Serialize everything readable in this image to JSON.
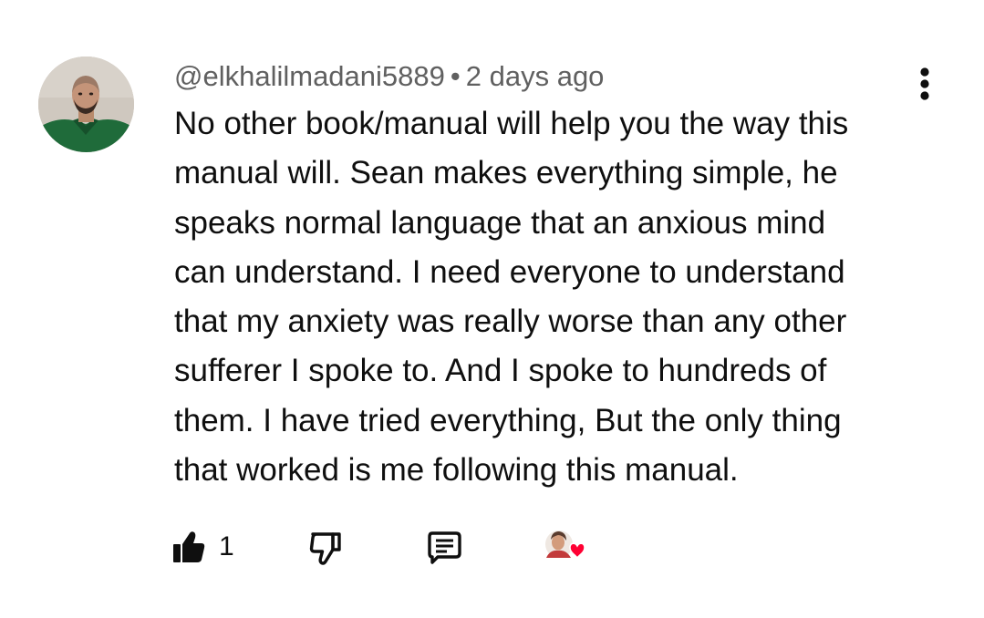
{
  "comment": {
    "author": "@elkhalilmadani5889",
    "separator": "•",
    "timestamp": "2 days ago",
    "text": "No other book/manual will help you the way this\nmanual will. Sean makes everything simple, he\nspeaks normal language that an anxious mind\ncan understand. I need everyone to understand\nthat my anxiety was really worse than any other\nsufferer I spoke to. And I spoke to hundreds of\nthem. I have tried everything, But the only thing\nthat worked is me following this manual.",
    "like_count": "1"
  },
  "icons": {
    "more": "more-vertical-icon",
    "like": "thumbs-up-filled-icon",
    "dislike": "thumbs-down-icon",
    "reply": "comment-reply-icon",
    "heart": "creator-heart-icon"
  },
  "colors": {
    "text": "#0f0f0f",
    "meta": "#606060",
    "heart": "#ff0033"
  }
}
